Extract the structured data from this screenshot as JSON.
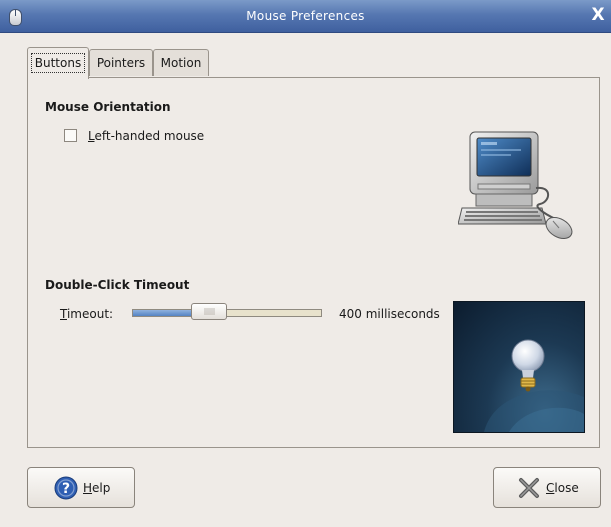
{
  "window": {
    "title": "Mouse Preferences",
    "close_glyph": "X"
  },
  "tabs": [
    {
      "label": "Buttons",
      "active": true
    },
    {
      "label": "Pointers",
      "active": false
    },
    {
      "label": "Motion",
      "active": false
    }
  ],
  "orientation": {
    "heading": "Mouse Orientation",
    "checkbox_label_mnemonic": "L",
    "checkbox_label_rest": "eft-handed mouse",
    "checked": false
  },
  "double_click": {
    "heading": "Double-Click Timeout",
    "timeout_label_mnemonic": "T",
    "timeout_label_rest": "imeout:",
    "value_ms": 400,
    "value_text": "400 milliseconds",
    "slider_fraction": 0.39
  },
  "images": {
    "computer": "computer-with-mouse-icon",
    "bulb": "lightbulb-test-icon"
  },
  "buttons": {
    "help_mnemonic": "H",
    "help_rest": "elp",
    "close_mnemonic": "C",
    "close_rest": "lose"
  },
  "colors": {
    "titlebar": "#4a6aa8",
    "window_bg": "#efebe7",
    "slider_fill": "#5483c3",
    "help_icon": "#2f5fb3"
  }
}
